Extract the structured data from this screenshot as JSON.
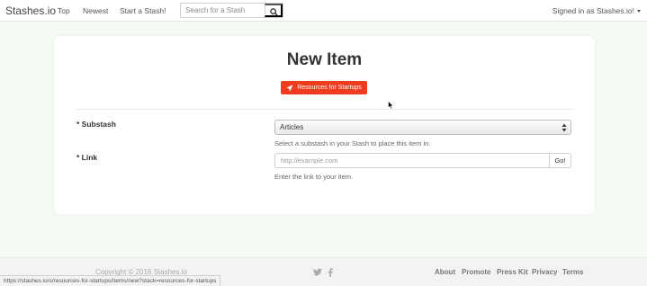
{
  "navbar": {
    "brand": "Stashes.io",
    "links": [
      "Top",
      "Newest",
      "Start a Stash!"
    ],
    "search_placeholder": "Search for a Stash",
    "signed_in": "Signed in as Stashes.io!"
  },
  "main": {
    "title": "New Item",
    "stash_button_label": "Resources for Startups",
    "substash": {
      "label": "* Substash",
      "value": "Articles",
      "help": "Select a substash in your Stash to place this item in."
    },
    "link": {
      "label": "* Link",
      "placeholder": "http://example.com",
      "go_label": "Go!",
      "help": "Enter the link to your item."
    }
  },
  "footer": {
    "copyright": "Copyright © 2016 Stashes.io",
    "social_icons": [
      "twitter-icon",
      "facebook-icon"
    ],
    "links": [
      "About",
      "Promote",
      "Press Kit",
      "Privacy",
      "Terms"
    ]
  },
  "status_bar": {
    "url": "https://stashes.io/s/resources-for-startups/items/new?stack=resources-for-startups"
  },
  "colors": {
    "accent": "#ef3b1e",
    "page_background": "#f3fbf3"
  }
}
